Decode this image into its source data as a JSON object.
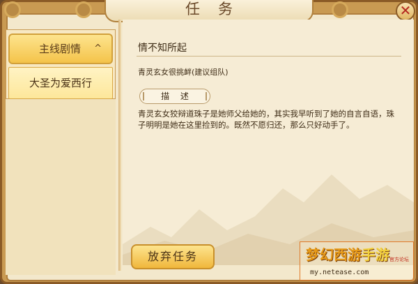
{
  "window": {
    "title": "任务",
    "close_label": "✕"
  },
  "sidebar": {
    "category": {
      "label": "主线剧情",
      "chevron": "^"
    },
    "items": [
      {
        "label": "大圣为爱西行",
        "selected": true
      }
    ]
  },
  "quest": {
    "name": "情不知所起",
    "hint": "青灵玄女很挑衅(建议组队)",
    "description_label": "描  述",
    "description": "青灵玄女狡辩道珠子是她师父给她的，其实我早听到了她的自言自语，珠子明明是她在这里捡到的。既然不愿归还，那么只好动手了。"
  },
  "actions": {
    "abandon_label": "放弃任务"
  },
  "watermark": {
    "brand": "梦幻西游",
    "brand_suffix": "手游",
    "tag": "官方论坛",
    "url": "my.netease.com"
  },
  "colors": {
    "frame": "#c99a52",
    "panel": "#f6ecd5",
    "button_gold": "#f4c34a",
    "text": "#3f2d17",
    "close_red": "#b3261e"
  }
}
